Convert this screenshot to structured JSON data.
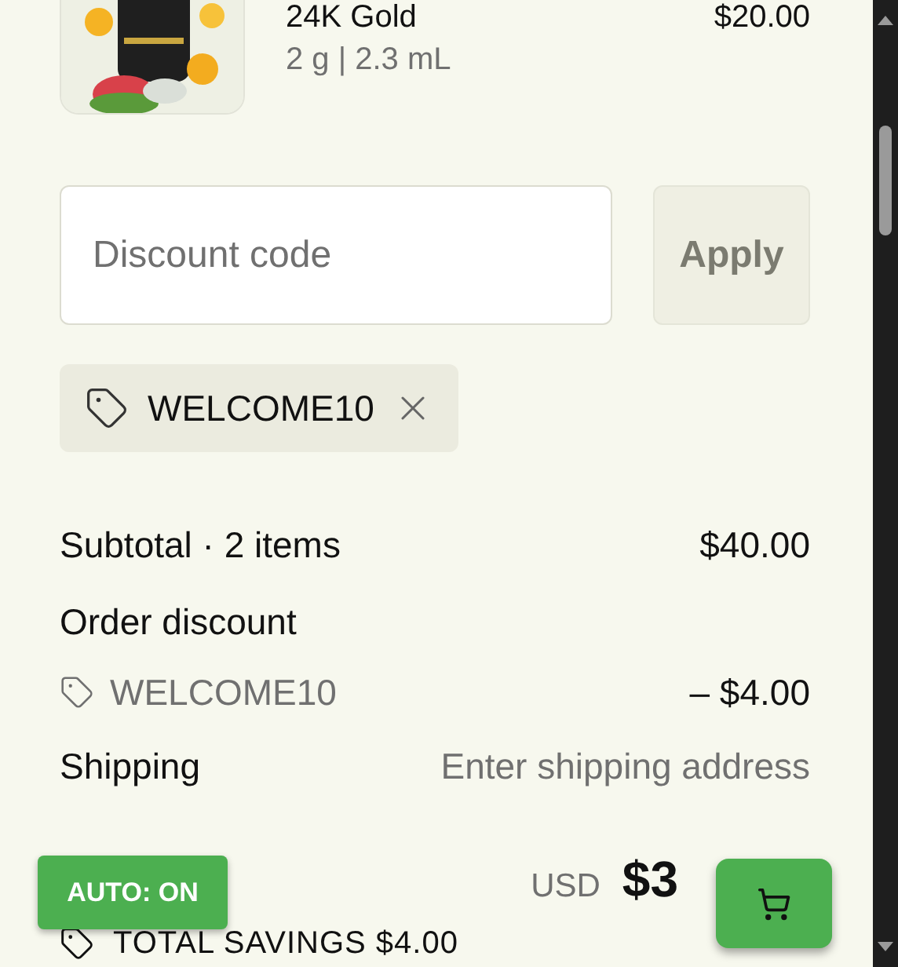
{
  "product": {
    "title": "24K Gold",
    "variant": "2 g | 2.3 mL",
    "price": "$20.00"
  },
  "discount": {
    "placeholder": "Discount code",
    "apply": "Apply"
  },
  "applied_code": {
    "code": "WELCOME10"
  },
  "summary": [
    {
      "kind": "line",
      "label": "Subtotal · 2 items",
      "value": "$40.00"
    },
    {
      "kind": "heading",
      "label": "Order discount"
    },
    {
      "kind": "code",
      "label": "WELCOME10",
      "value": "– $4.00"
    },
    {
      "kind": "pending",
      "label": "Shipping",
      "value": "Enter shipping address"
    }
  ],
  "total": {
    "currency": "USD",
    "amount": "$3"
  },
  "savings": {
    "label": "TOTAL SAVINGS",
    "amount": "$4.00"
  },
  "auto_button": {
    "label": "AUTO: ON",
    "on": true
  }
}
